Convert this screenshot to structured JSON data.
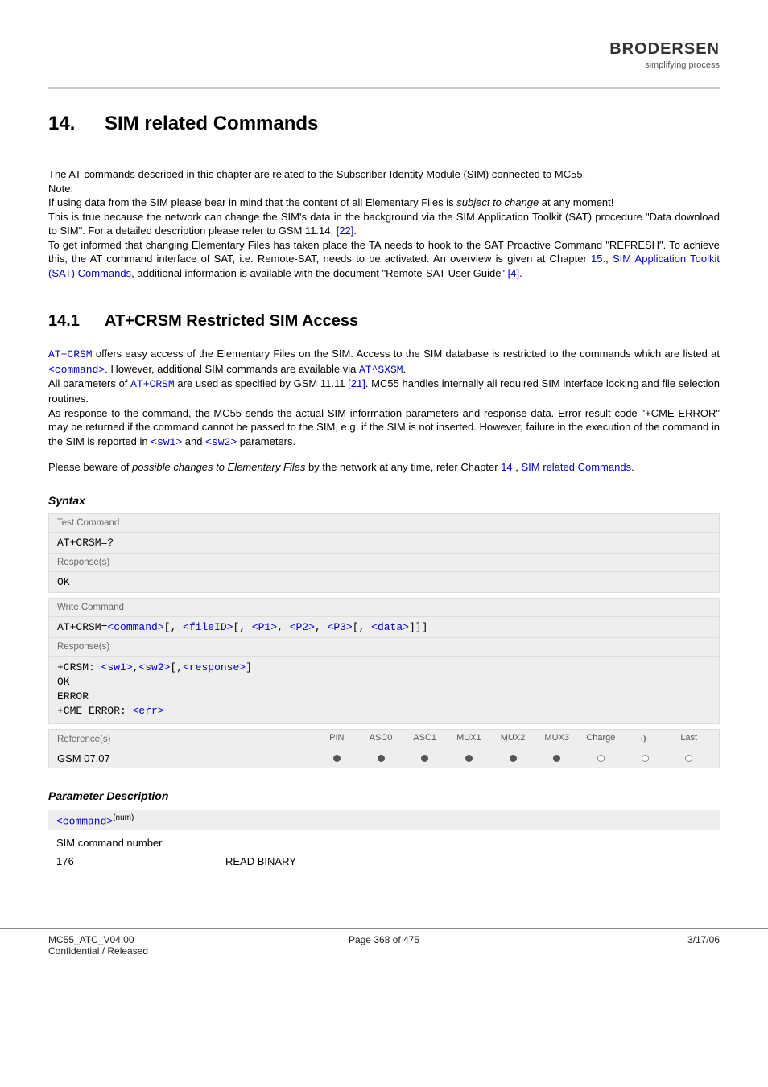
{
  "header": {
    "logo_brand": "BRODERSEN",
    "logo_tagline": "simplifying process"
  },
  "chapter": {
    "number": "14.",
    "title": "SIM related Commands"
  },
  "intro": {
    "p1": "The AT commands described in this chapter are related to the Subscriber Identity Module (SIM) connected to MC55.",
    "note_label": " Note:",
    "p2a": "If using data from the SIM please bear in mind that the content of all Elementary Files is ",
    "p2_em": "subject to change",
    "p2b": " at any moment!",
    "p3a": "This is true because the network can change the SIM's data in the background via the SIM Application Toolkit (SAT) procedure \"Data download to SIM\". For a detailed description please refer to GSM 11.14, ",
    "p3_ref": "[22]",
    "p3b": ".",
    "p4a": "To get informed that changing Elementary Files has taken place the TA needs to hook to the SAT Proactive Command \"REFRESH\". To achieve this, the AT command interface of SAT, i.e. Remote-SAT, needs to be activated. An overview is given at Chapter ",
    "p4_link1": "15.",
    "p4b": ", ",
    "p4_link2": "SIM Application Toolkit (SAT) Commands",
    "p4c": ", additional information is available with the document \"Remote-SAT User Guide\" ",
    "p4_ref": "[4]",
    "p4d": "."
  },
  "section": {
    "number": "14.1",
    "title": "AT+CRSM   Restricted SIM Access"
  },
  "sectbody": {
    "p1a_code": "AT+CRSM",
    "p1a": " offers easy access of the Elementary Files on the SIM. Access to the SIM database is restricted to the commands which are listed at ",
    "p1b_code": "<command>",
    "p1b": ". However, additional SIM commands are available via ",
    "p1c_code": "AT^SXSM",
    "p1c": ".",
    "p2a": "All parameters of ",
    "p2a_code": "AT+CRSM",
    "p2b": " are used as specified by GSM 11.11 ",
    "p2_ref": "[21]",
    "p2c": ". MC55 handles internally all required SIM interface locking and file selection routines.",
    "p3a": "As response to the command, the MC55 sends the actual SIM information parameters and response data. Error result code \"+CME ERROR\" may be returned if the command cannot be passed to the SIM, e.g. if the SIM is not inserted. However, failure in the execution of the command in the SIM is reported in ",
    "p3_code1": "<sw1>",
    "p3b": " and ",
    "p3_code2": "<sw2>",
    "p3c": " parameters.",
    "p4a": "Please beware of ",
    "p4_em": "possible changes to Elementary Files",
    "p4b": " by the network at any time, refer Chapter ",
    "p4_link1": "14.",
    "p4c": ", ",
    "p4_link2": "SIM related Commands",
    "p4d": "."
  },
  "syntax": {
    "heading": "Syntax",
    "test_label": "Test Command",
    "test_cmd": "AT+CRSM=?",
    "resp_label": "Response(s)",
    "test_resp": "OK",
    "write_label": "Write Command",
    "write_cmd_prefix": "AT+CRSM=",
    "write_parts": {
      "command": "<command>",
      "fileID": "<fileID>",
      "P1": "<P1>",
      "P2": "<P2>",
      "P3": "<P3>",
      "data": "<data>"
    },
    "write_resp_prefix": "+CRSM: ",
    "write_resp_parts": {
      "sw1": "<sw1>",
      "sw2": "<sw2>",
      "response": "<response>"
    },
    "write_resp_l2": "OK",
    "write_resp_l3": "ERROR",
    "write_resp_l4a": "+CME ERROR: ",
    "write_resp_l4b": "<err>",
    "ref_label": "Reference(s)",
    "ref_value": "GSM 07.07",
    "cols": [
      "PIN",
      "ASC0",
      "ASC1",
      "MUX1",
      "MUX2",
      "MUX3",
      "Charge",
      "",
      "Last"
    ],
    "dots": [
      "filled",
      "filled",
      "filled",
      "filled",
      "filled",
      "filled",
      "empty",
      "empty",
      "empty"
    ]
  },
  "params": {
    "heading": "Parameter Description",
    "command_param": "<command>",
    "command_sup": "(num)",
    "command_desc": "SIM command number.",
    "rows": [
      {
        "value": "176",
        "meaning": "READ BINARY"
      }
    ]
  },
  "footer": {
    "left1": "MC55_ATC_V04.00",
    "left2": "Confidential / Released",
    "mid": "Page 368 of 475",
    "right": "3/17/06"
  }
}
